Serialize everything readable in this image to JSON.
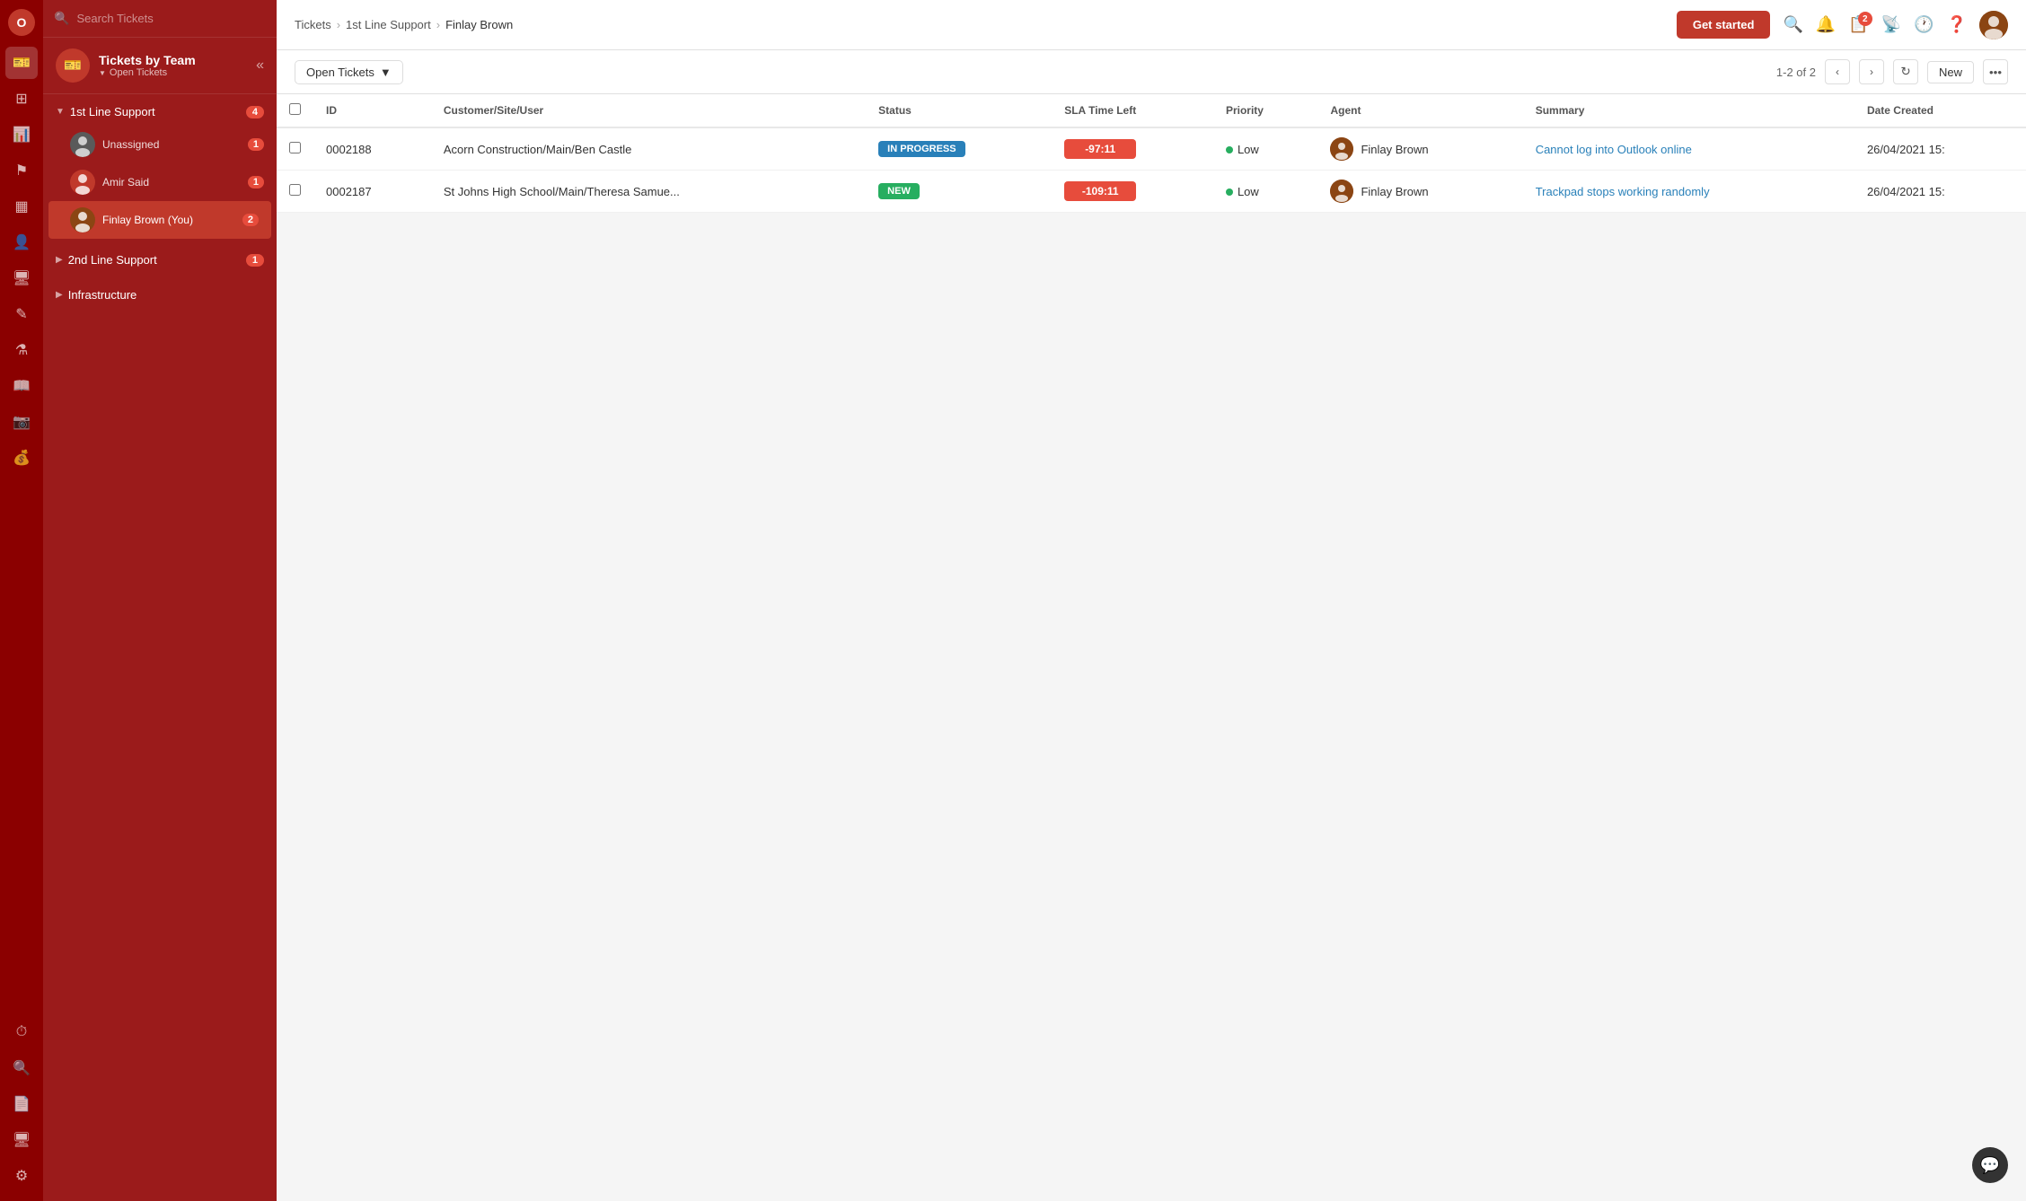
{
  "app": {
    "logo": "O"
  },
  "iconBar": {
    "icons": [
      {
        "name": "ticket-icon",
        "symbol": "🎫",
        "active": true
      },
      {
        "name": "dashboard-icon",
        "symbol": "⊞"
      },
      {
        "name": "chart-icon",
        "symbol": "📊"
      },
      {
        "name": "flag-icon",
        "symbol": "🚩"
      },
      {
        "name": "calendar-icon",
        "symbol": "📅"
      },
      {
        "name": "contacts-icon",
        "symbol": "👤"
      },
      {
        "name": "monitor-icon",
        "symbol": "🖥"
      },
      {
        "name": "edit-icon",
        "symbol": "✏️"
      },
      {
        "name": "lab-icon",
        "symbol": "🧪"
      },
      {
        "name": "book-icon",
        "symbol": "📖"
      },
      {
        "name": "camera-icon",
        "symbol": "📷"
      },
      {
        "name": "billing-icon",
        "symbol": "💰"
      },
      {
        "name": "clock-icon",
        "symbol": "⏰"
      },
      {
        "name": "search-icon-bar",
        "symbol": "🔍"
      },
      {
        "name": "report-icon",
        "symbol": "📄"
      },
      {
        "name": "screen-icon",
        "symbol": "🖥"
      },
      {
        "name": "settings-icon",
        "symbol": "⚙️"
      }
    ]
  },
  "sidebar": {
    "search_placeholder": "Search Tickets",
    "header": {
      "title": "Tickets by Team",
      "subtitle": "Open Tickets"
    },
    "teams": [
      {
        "name": "1st Line Support",
        "badge": 4,
        "expanded": true,
        "agents": [
          {
            "name": "Unassigned",
            "badge": 1,
            "active": false
          },
          {
            "name": "Amir Said",
            "badge": 1,
            "active": false
          },
          {
            "name": "Finlay Brown (You)",
            "badge": 2,
            "active": true
          }
        ]
      },
      {
        "name": "2nd Line Support",
        "badge": 1,
        "expanded": false,
        "agents": []
      },
      {
        "name": "Infrastructure",
        "badge": null,
        "expanded": false,
        "agents": []
      }
    ]
  },
  "topbar": {
    "breadcrumb": {
      "root": "Tickets",
      "level1": "1st Line Support",
      "level2": "Finlay Brown"
    },
    "get_started_label": "Get started",
    "notification_badge": "2"
  },
  "content": {
    "filter_label": "Open Tickets",
    "pagination": {
      "info": "1-2 of 2"
    },
    "new_label": "New",
    "table": {
      "headers": [
        "",
        "ID",
        "Customer/Site/User",
        "Status",
        "SLA Time Left",
        "Priority",
        "Agent",
        "Summary",
        "Date Created"
      ],
      "rows": [
        {
          "id": "0002188",
          "customer": "Acorn Construction/Main/Ben Castle",
          "status": "IN PROGRESS",
          "status_type": "in-progress",
          "sla": "-97:11",
          "priority": "Low",
          "agent_name": "Finlay Brown",
          "summary": "Cannot log into Outlook online",
          "date_created": "26/04/2021 15:"
        },
        {
          "id": "0002187",
          "customer": "St Johns High School/Main/Theresa Samue...",
          "status": "NEW",
          "status_type": "new",
          "sla": "-109:11",
          "priority": "Low",
          "agent_name": "Finlay Brown",
          "summary": "Trackpad stops working randomly",
          "date_created": "26/04/2021 15:"
        }
      ]
    }
  }
}
